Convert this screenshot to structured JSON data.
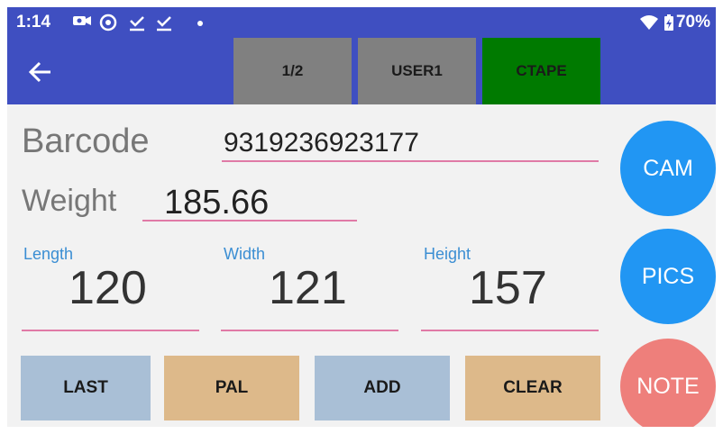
{
  "status_bar": {
    "time": "1:14",
    "battery": "70%",
    "icons": [
      "video-icon",
      "sync-icon",
      "check-icon",
      "check-icon",
      "dot-icon",
      "wifi-icon",
      "battery-charging-icon"
    ]
  },
  "app_bar": {
    "page": "1/2",
    "user": "USER1",
    "mode": "CTAPE"
  },
  "form": {
    "barcode_label": "Barcode",
    "barcode_value": "9319236923177",
    "weight_label": "Weight",
    "weight_value": "185.66",
    "length_label": "Length",
    "length_value": "120",
    "width_label": "Width",
    "width_value": "121",
    "height_label": "Height",
    "height_value": "157"
  },
  "buttons": {
    "last": "LAST",
    "pal": "PAL",
    "add": "ADD",
    "clear": "CLEAR",
    "cam": "CAM",
    "pics": "PICS",
    "note": "NOTE"
  },
  "colors": {
    "primary": "#3f4fc1",
    "ctape": "#007a00",
    "tab_gray": "#808080",
    "blue_btn": "#a9bfd6",
    "tan_btn": "#ddb98a",
    "fab_blue": "#2196f3",
    "fab_red": "#ee7f7b",
    "underline": "#e07aa6"
  }
}
